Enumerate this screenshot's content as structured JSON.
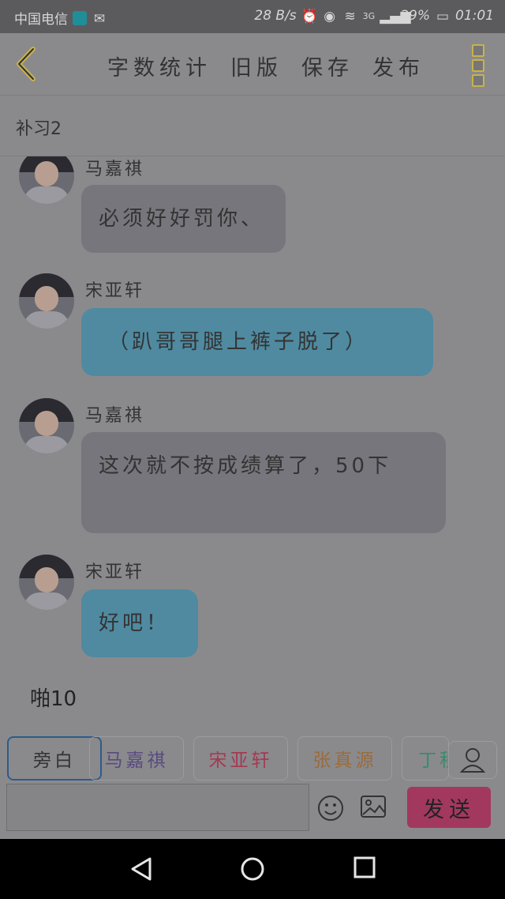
{
  "status": {
    "carrier": "中国电信",
    "speed": "28 B/s",
    "network": "3G",
    "battery": "29%",
    "time": "01:01"
  },
  "toolbar": {
    "word_count": "字数统计",
    "old_version": "旧版",
    "save": "保存",
    "publish": "发布"
  },
  "story_title": "补习2",
  "messages": [
    {
      "speaker": "马嘉祺",
      "text": "必须好好罚你、"
    },
    {
      "speaker": "宋亚轩",
      "text": "（趴哥哥腿上裤子脱了）"
    },
    {
      "speaker": "马嘉祺",
      "text": "这次就不按成绩算了，50下"
    },
    {
      "speaker": "宋亚轩",
      "text": "好吧！"
    }
  ],
  "narration": "啪10",
  "roles": [
    {
      "label": "旁白",
      "color": "#2e3a55"
    },
    {
      "label": "马嘉祺",
      "color": "#5a4a80"
    },
    {
      "label": "宋亚轩",
      "color": "#a33a52"
    },
    {
      "label": "张真源",
      "color": "#9b6b3a"
    },
    {
      "label": "丁程鑫",
      "color": "#3a8a6a"
    }
  ],
  "send_label": "发送",
  "colors": {
    "send_button": "#a3385f",
    "blue_bubble": "#4f8aa0",
    "gray_bubble": "#76767c",
    "accent": "#c8b24d"
  }
}
